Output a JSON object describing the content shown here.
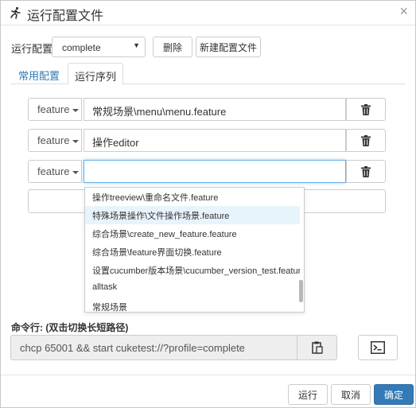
{
  "dialog": {
    "title": "运行配置文件",
    "close": "×"
  },
  "config": {
    "label": "运行配置",
    "selected": "complete",
    "delete_label": "删除",
    "new_label": "新建配置文件"
  },
  "tabs": [
    {
      "label": "常用配置",
      "active": false
    },
    {
      "label": "运行序列",
      "active": true
    }
  ],
  "sequence": [
    {
      "type": "feature",
      "value": "常规场景\\menu\\menu.feature"
    },
    {
      "type": "feature",
      "value": "操作editor"
    },
    {
      "type": "feature",
      "value": ""
    }
  ],
  "suggestions": [
    "操作treeview\\重命名文件.feature",
    "特殊场景操作\\文件操作场景.feature",
    "综合场景\\create_new_feature.feature",
    "综合场景\\feature界面切换.feature",
    "设置cucumber版本场景\\cucumber_version_test.feature",
    "alltask",
    "常规场景"
  ],
  "suggestions_highlighted": 1,
  "command": {
    "label": "命令行: (双击切换长短路径)",
    "value": "chcp 65001 && start cuketest://?profile=complete"
  },
  "footer": {
    "run_label": "运行",
    "cancel_label": "取消",
    "ok_label": "确定"
  },
  "colors": {
    "accent": "#337ab7",
    "highlight": "#e8f4fb",
    "focus": "#66afe9"
  },
  "icons": [
    "runner-icon",
    "close-icon",
    "trash-icon",
    "clipboard-icon",
    "terminal-icon",
    "caret-down-icon"
  ]
}
